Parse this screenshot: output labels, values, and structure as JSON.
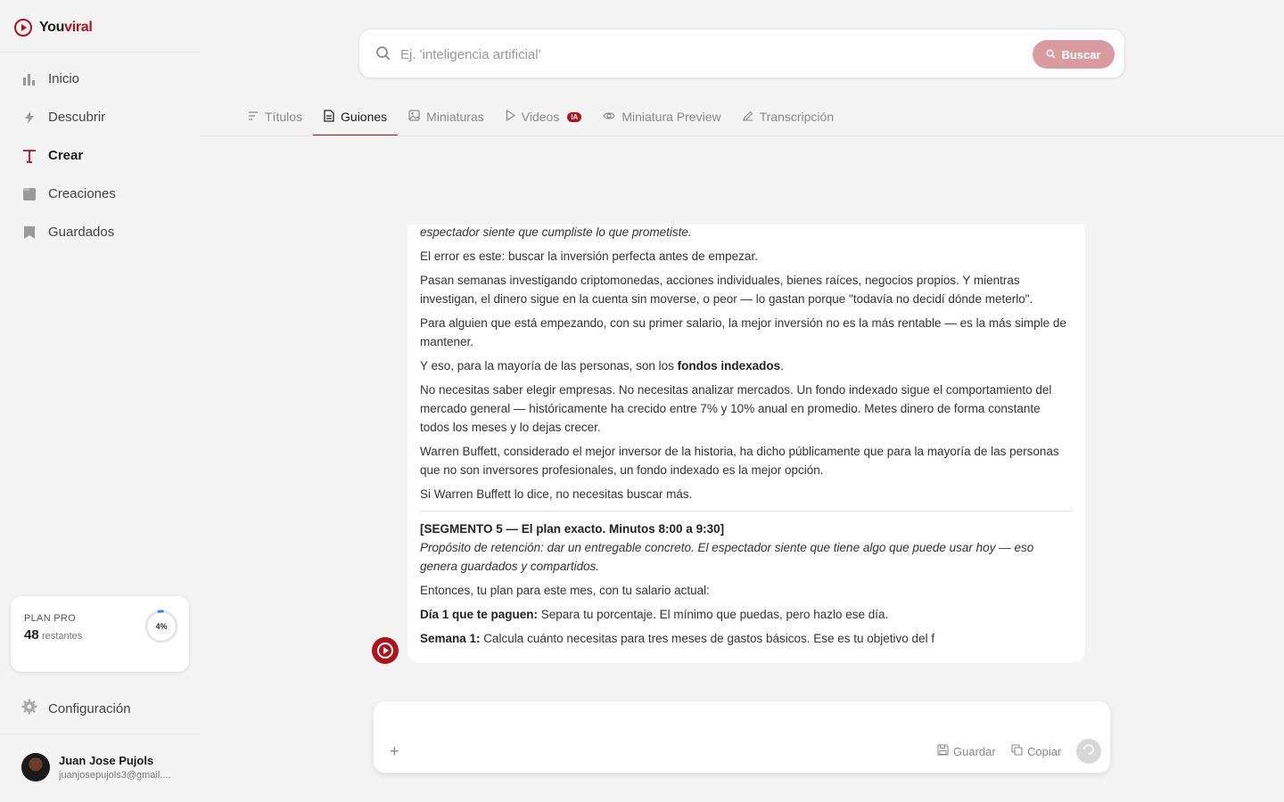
{
  "brand": {
    "name_part1": "You",
    "name_part2": "viral"
  },
  "sidebar": {
    "items": [
      {
        "label": "Inicio",
        "icon": "bar-chart-icon"
      },
      {
        "label": "Descubrir",
        "icon": "bolt-icon"
      },
      {
        "label": "Crear",
        "icon": "text-t-icon",
        "active": true
      },
      {
        "label": "Creaciones",
        "icon": "folder-icon"
      },
      {
        "label": "Guardados",
        "icon": "bookmark-icon"
      }
    ],
    "plan": {
      "label": "PLAN PRO",
      "count": "48",
      "rest_label": "restantes",
      "percent_text": "4%",
      "percent_value": 4
    },
    "config_label": "Configuración",
    "user": {
      "name": "Juan Jose Pujols",
      "email": "juanjosepujols3@gmail...."
    }
  },
  "search": {
    "placeholder": "Ej. 'inteligencia artificial'",
    "button_label": "Buscar"
  },
  "tabs": [
    {
      "label": "Títulos",
      "icon": "lines-icon"
    },
    {
      "label": "Guiones",
      "icon": "document-icon",
      "active": true
    },
    {
      "label": "Miniaturas",
      "icon": "image-icon"
    },
    {
      "label": "Videos",
      "icon": "play-icon",
      "badge": "IA"
    },
    {
      "label": "Miniatura Preview",
      "icon": "eye-icon"
    },
    {
      "label": "Transcripción",
      "icon": "pencil-icon"
    }
  ],
  "message": {
    "p1": "espectador siente que cumpliste lo que prometiste.",
    "p2": "El error es este: buscar la inversión perfecta antes de empezar.",
    "p3": "Pasan semanas investigando criptomonedas, acciones individuales, bienes raíces, negocios propios. Y mientras investigan, el dinero sigue en la cuenta sin moverse, o peor — lo gastan porque \"todavía no decidí dónde meterlo\".",
    "p4": "Para alguien que está empezando, con su primer salario, la mejor inversión no es la más rentable — es la más simple de mantener.",
    "p5_prefix": "Y eso, para la mayoría de las personas, son los ",
    "p5_bold": "fondos indexados",
    "p5_suffix": ".",
    "p6": "No necesitas saber elegir empresas. No necesitas analizar mercados. Un fondo indexado sigue el comportamiento del mercado general — históricamente ha crecido entre 7% y 10% anual en promedio. Metes dinero de forma constante todos los meses y lo dejas crecer.",
    "p7": "Warren Buffett, considerado el mejor inversor de la historia, ha dicho públicamente que para la mayoría de las personas que no son inversores profesionales, un fondo indexado es la mejor opción.",
    "p8": "Si Warren Buffett lo dice, no necesitas buscar más.",
    "seg_title": "[SEGMENTO 5 — El plan exacto. Minutos 8:00 a 9:30]",
    "seg_purpose": "Propósito de retención: dar un entregable concreto. El espectador siente que tiene algo que puede usar hoy — eso genera guardados y compartidos.",
    "p9": "Entonces, tu plan para este mes, con tu salario actual:",
    "d1_bold": "Día 1 que te paguen:",
    "d1_text": " Separa tu porcentaje. El mínimo que puedas, pero hazlo ese día.",
    "s1_bold": "Semana 1:",
    "s1_text": " Calcula cuánto necesitas para tres meses de gastos básicos. Ese es tu objetivo del f"
  },
  "composer": {
    "save_label": "Guardar",
    "copy_label": "Copiar"
  },
  "colors": {
    "accent": "#b0121b",
    "search_button": "#d99aa0"
  }
}
